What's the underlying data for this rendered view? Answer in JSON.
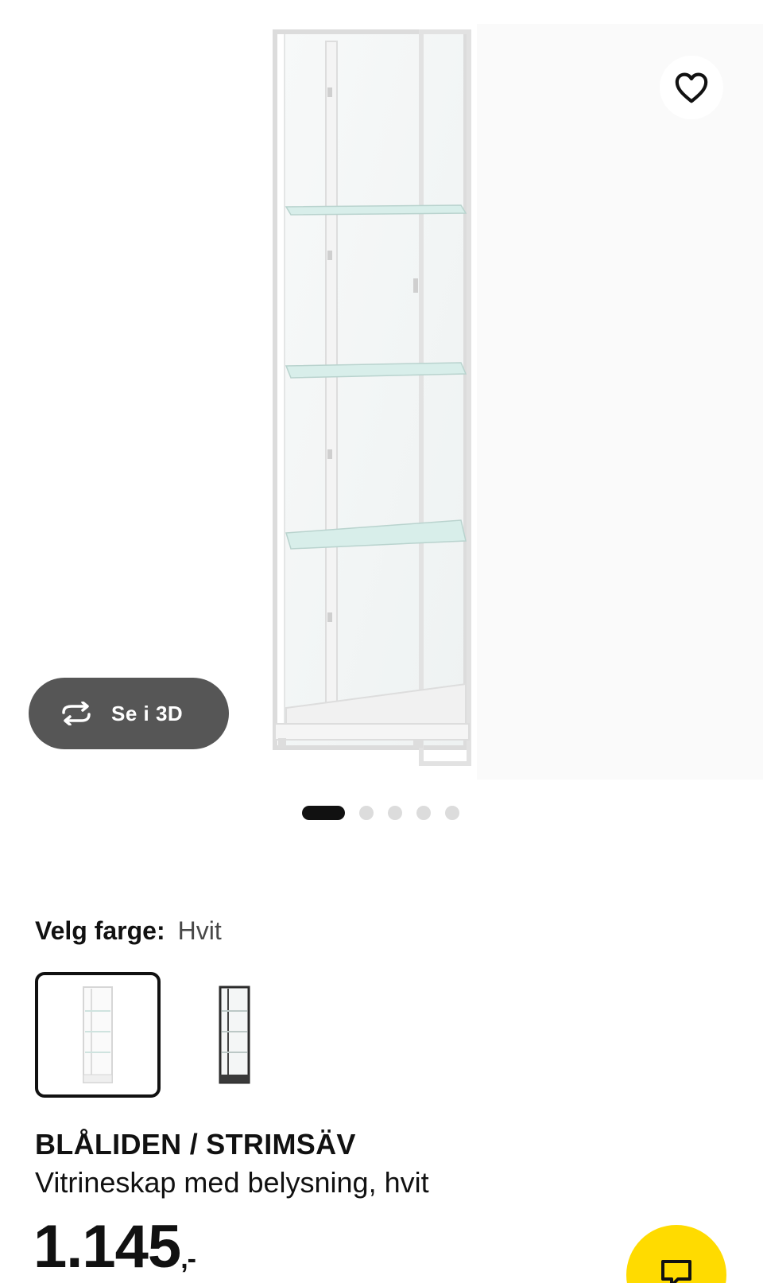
{
  "gallery": {
    "view_3d_label": "Se i 3D",
    "slide_count": 5,
    "active_slide": 1
  },
  "color": {
    "label": "Velg farge:",
    "selected_value": "Hvit",
    "options": [
      {
        "name": "white-variant",
        "frame_color": "#f2f2f2"
      },
      {
        "name": "black-variant",
        "frame_color": "#2b2b2b"
      }
    ]
  },
  "product": {
    "name": "BLÅLIDEN / STRIMSÄV",
    "description": "Vitrineskap med belysning, hvit",
    "price": "1.145",
    "price_suffix": ",-"
  },
  "colors": {
    "accent_yellow": "#FFDB00",
    "button_dark": "#565656",
    "text": "#111111"
  },
  "icons": {
    "favorite": "heart-outline-icon",
    "view_3d": "rotate-arrows-icon",
    "chat": "chat-bubble-icon"
  }
}
